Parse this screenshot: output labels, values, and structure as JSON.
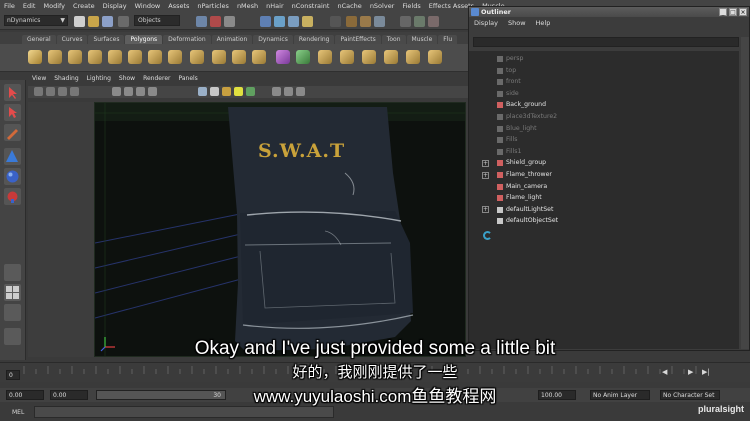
{
  "menubar": [
    "File",
    "Edit",
    "Modify",
    "Create",
    "Display",
    "Window",
    "Assets",
    "nParticles",
    "nMesh",
    "nHair",
    "nConstraint",
    "nCache",
    "nSolver",
    "Fields",
    "Effects Assets",
    "Muscle"
  ],
  "statusline": {
    "mode": "nDynamics",
    "objects_label": "Objects"
  },
  "shelf": {
    "tabs": [
      "General",
      "Curves",
      "Surfaces",
      "Polygons",
      "Deformation",
      "Animation",
      "Dynamics",
      "Rendering",
      "PaintEffects",
      "Toon",
      "Muscle",
      "Flu"
    ],
    "active": "Polygons"
  },
  "panel": {
    "menu": [
      "View",
      "Shading",
      "Lighting",
      "Show",
      "Renderer",
      "Panels"
    ]
  },
  "viewport": {
    "badge_text": "S.W.A.T"
  },
  "outliner": {
    "title": "Outliner",
    "menu": [
      "Display",
      "Show",
      "Help"
    ],
    "items": [
      {
        "label": "persp",
        "dim": true,
        "expand": false
      },
      {
        "label": "top",
        "dim": true,
        "expand": false
      },
      {
        "label": "front",
        "dim": true,
        "expand": false
      },
      {
        "label": "side",
        "dim": true,
        "expand": false
      },
      {
        "label": "Back_ground",
        "dim": false,
        "expand": false
      },
      {
        "label": "place3dTexture2",
        "dim": true,
        "expand": false
      },
      {
        "label": "Blue_light",
        "dim": true,
        "expand": false
      },
      {
        "label": "Fills",
        "dim": true,
        "expand": false
      },
      {
        "label": "Fills1",
        "dim": true,
        "expand": false
      },
      {
        "label": "Shield_group",
        "dim": false,
        "expand": true
      },
      {
        "label": "Flame_thrower",
        "dim": false,
        "expand": true
      },
      {
        "label": "Main_camera",
        "dim": false,
        "expand": false
      },
      {
        "label": "Flame_light",
        "dim": false,
        "expand": false
      },
      {
        "label": "defaultLightSet",
        "dim": false,
        "expand": true
      },
      {
        "label": "defaultObjectSet",
        "dim": false,
        "expand": false
      }
    ]
  },
  "timeline": {
    "current_frame": "0"
  },
  "range": {
    "start": "0.00",
    "playback_start": "0.00",
    "slider_value": "30",
    "end": "100.00",
    "anim_layer": "No Anim Layer",
    "character_set": "No Character Set"
  },
  "mel": {
    "label": "MEL"
  },
  "subtitles": {
    "english": "Okay and I've just provided some a little bit",
    "chinese": "好的，我刚刚提供了一些",
    "site": "www.yuyulaoshi.com鱼鱼教程网"
  },
  "branding": {
    "logo": "pluralsight"
  },
  "colors": {
    "accent_blue": "#2f6fb0",
    "outliner_bg": "#2c2c2c"
  }
}
